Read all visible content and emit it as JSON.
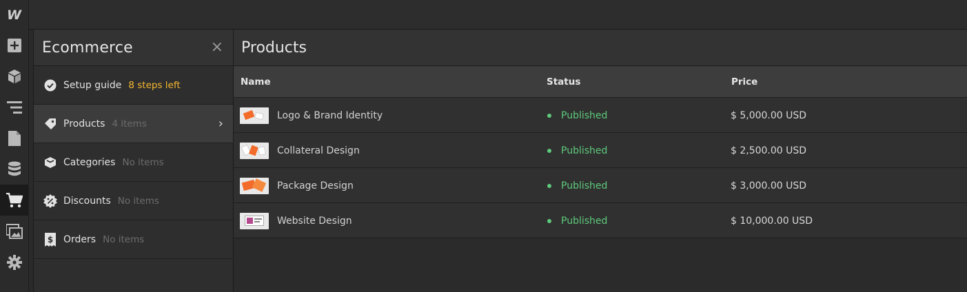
{
  "topbar": {
    "logo_text": "W"
  },
  "leftbar": {
    "items": [
      {
        "icon": "add-icon",
        "active": false
      },
      {
        "icon": "box-icon",
        "active": false
      },
      {
        "icon": "navigator-icon",
        "active": false
      },
      {
        "icon": "page-icon",
        "active": false
      },
      {
        "icon": "database-icon",
        "active": false
      },
      {
        "icon": "cart-icon",
        "active": true
      },
      {
        "icon": "assets-icon",
        "active": false
      },
      {
        "icon": "gear-icon",
        "active": false
      }
    ]
  },
  "panel": {
    "title": "Ecommerce",
    "close_label": "×",
    "items": [
      {
        "label": "Setup guide",
        "meta": "8 steps left",
        "icon": "check-circle-icon"
      },
      {
        "label": "Products",
        "meta": "4 items",
        "icon": "tag-icon",
        "chevron": "›"
      },
      {
        "label": "Categories",
        "meta": "No items",
        "icon": "category-box-icon"
      },
      {
        "label": "Discounts",
        "meta": "No items",
        "icon": "discount-badge-icon"
      },
      {
        "label": "Orders",
        "meta": "No items",
        "icon": "receipt-icon"
      }
    ]
  },
  "main": {
    "title": "Products",
    "columns": {
      "name": "Name",
      "status": "Status",
      "price": "Price"
    },
    "rows": [
      {
        "name": "Logo & Brand Identity",
        "status": "Published",
        "price": "$ 5,000.00 USD"
      },
      {
        "name": "Collateral Design",
        "status": "Published",
        "price": "$ 2,500.00 USD"
      },
      {
        "name": "Package Design",
        "status": "Published",
        "price": "$ 3,000.00 USD"
      },
      {
        "name": "Website Design",
        "status": "Published",
        "price": "$ 10,000.00 USD"
      }
    ]
  },
  "colors": {
    "accent_warn": "#f5b830",
    "published": "#5ecb7c"
  }
}
